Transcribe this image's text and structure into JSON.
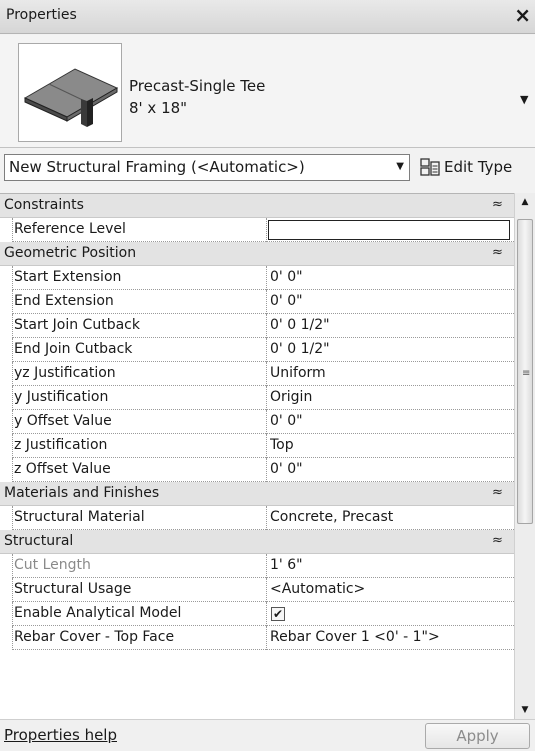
{
  "window": {
    "title": "Properties",
    "close_glyph": "×"
  },
  "type_selector": {
    "name": "Precast-Single Tee",
    "size": "8' x 18\"",
    "icon": "precast-tee-thumbnail"
  },
  "instance_selector": {
    "value": "New Structural Framing (<Automatic>)"
  },
  "edit_type": {
    "label": "Edit Type",
    "icon": "edit-type-icon"
  },
  "groups": {
    "constraints": "Constraints",
    "geometric": "Geometric Position",
    "materials": "Materials and Finishes",
    "structural": "Structural",
    "collapse_glyph": "≈"
  },
  "constraints": {
    "reference_level": {
      "name": "Reference Level",
      "value": ""
    }
  },
  "geometric": [
    {
      "name": "Start Extension",
      "value": "0'  0\""
    },
    {
      "name": "End Extension",
      "value": "0'  0\""
    },
    {
      "name": "Start Join Cutback",
      "value": "0'  0 1/2\""
    },
    {
      "name": "End Join Cutback",
      "value": "0'  0 1/2\""
    },
    {
      "name": "yz Justification",
      "value": "Uniform"
    },
    {
      "name": "y Justification",
      "value": "Origin"
    },
    {
      "name": "y Offset Value",
      "value": "0'  0\""
    },
    {
      "name": "z Justification",
      "value": "Top"
    },
    {
      "name": "z Offset Value",
      "value": "0'  0\""
    }
  ],
  "materials": [
    {
      "name": "Structural Material",
      "value": "Concrete, Precast"
    }
  ],
  "structural": {
    "cut_length": {
      "name": "Cut Length",
      "value": "1'  6\""
    },
    "usage": {
      "name": "Structural Usage",
      "value": "<Automatic>"
    },
    "analytical": {
      "name": "Enable Analytical Model",
      "checked": "✔"
    },
    "rebar_top": {
      "name": "Rebar Cover - Top Face",
      "value": "Rebar Cover 1 <0' - 1\">"
    }
  },
  "footer": {
    "help_link": "Properties help",
    "apply": "Apply"
  }
}
